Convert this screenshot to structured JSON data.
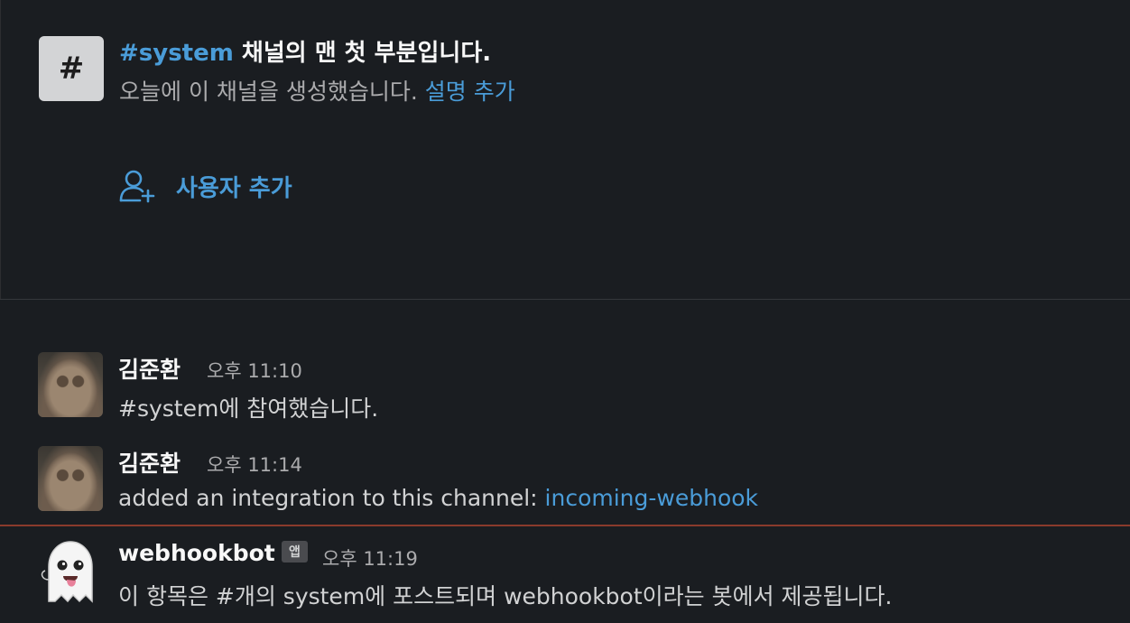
{
  "channel_intro": {
    "icon_glyph": "#",
    "channel_name": "#system",
    "title_rest": " 채널의 맨 첫 부분입니다.",
    "subtitle": "오늘에 이 채널을 생성했습니다. ",
    "add_description_link": "설명 추가",
    "add_user_label": "사용자 추가",
    "add_user_icon": "add-user-icon"
  },
  "messages": [
    {
      "sender": "김준환",
      "time": "오후 11:10",
      "text": "#system에 참여했습니다.",
      "avatar": "cat-avatar"
    },
    {
      "sender": "김준환",
      "time": "오후 11:14",
      "text": "added an integration to this channel: ",
      "link": "incoming-webhook",
      "avatar": "cat-avatar"
    },
    {
      "sender": "webhookbot",
      "badge": "앱",
      "time": "오후 11:19",
      "text": "이 항목은 #개의 system에 포스트되며 webhookbot이라는 봇에서 제공됩니다.",
      "avatar": "ghost-emoji-avatar"
    }
  ],
  "colors": {
    "background": "#1a1d21",
    "link": "#4a9cd8",
    "new_message_divider": "#8a3a2c"
  }
}
